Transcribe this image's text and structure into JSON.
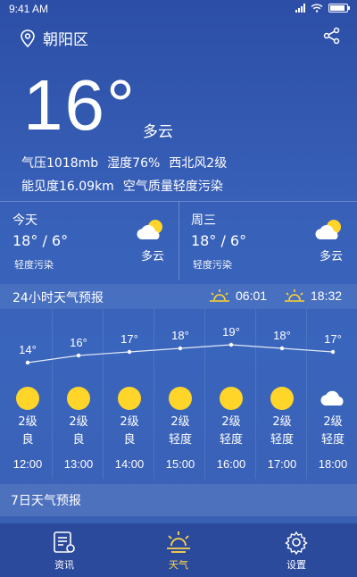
{
  "status": {
    "time": "9:41 AM"
  },
  "location": {
    "name": "朝阳区"
  },
  "current": {
    "temperature": "16°",
    "condition": "多云",
    "pressure": "气压1018mb",
    "humidity": "湿度76%",
    "wind": "西北风2级",
    "visibility": "能见度16.09km",
    "air_quality": "空气质量轻度污染"
  },
  "days": [
    {
      "label": "今天",
      "range": "18° / 6°",
      "aqi": "轻度污染",
      "condition": "多云",
      "icon": "partly-cloudy-icon"
    },
    {
      "label": "周三",
      "range": "18° / 6°",
      "aqi": "轻度污染",
      "condition": "多云",
      "icon": "partly-cloudy-icon"
    }
  ],
  "hourly": {
    "title": "24小时天气预报",
    "sunrise": "06:01",
    "sunset": "18:32",
    "items": [
      {
        "temp": "14°",
        "temp_value": 14,
        "icon": "sun-icon",
        "wind": "2级",
        "aqi": "良",
        "time": "12:00"
      },
      {
        "temp": "16°",
        "temp_value": 16,
        "icon": "sun-icon",
        "wind": "2级",
        "aqi": "良",
        "time": "13:00"
      },
      {
        "temp": "17°",
        "temp_value": 17,
        "icon": "sun-icon",
        "wind": "2级",
        "aqi": "良",
        "time": "14:00"
      },
      {
        "temp": "18°",
        "temp_value": 18,
        "icon": "sun-icon",
        "wind": "2级",
        "aqi": "轻度",
        "time": "15:00"
      },
      {
        "temp": "19°",
        "temp_value": 19,
        "icon": "sun-icon",
        "wind": "2级",
        "aqi": "轻度",
        "time": "16:00"
      },
      {
        "temp": "18°",
        "temp_value": 18,
        "icon": "sun-icon",
        "wind": "2级",
        "aqi": "轻度",
        "time": "17:00"
      },
      {
        "temp": "17°",
        "temp_value": 17,
        "icon": "cloud-icon",
        "wind": "2级",
        "aqi": "轻度",
        "time": "18:00"
      }
    ]
  },
  "weekly": {
    "title": "7日天气预报"
  },
  "tabs": [
    {
      "label": "资讯",
      "icon": "news-icon",
      "active": false
    },
    {
      "label": "天气",
      "icon": "weather-icon",
      "active": true
    },
    {
      "label": "设置",
      "icon": "gear-icon",
      "active": false
    }
  ],
  "colors": {
    "accent": "#ffd54a",
    "background": "#3560b6",
    "sun": "#ffd52a"
  }
}
